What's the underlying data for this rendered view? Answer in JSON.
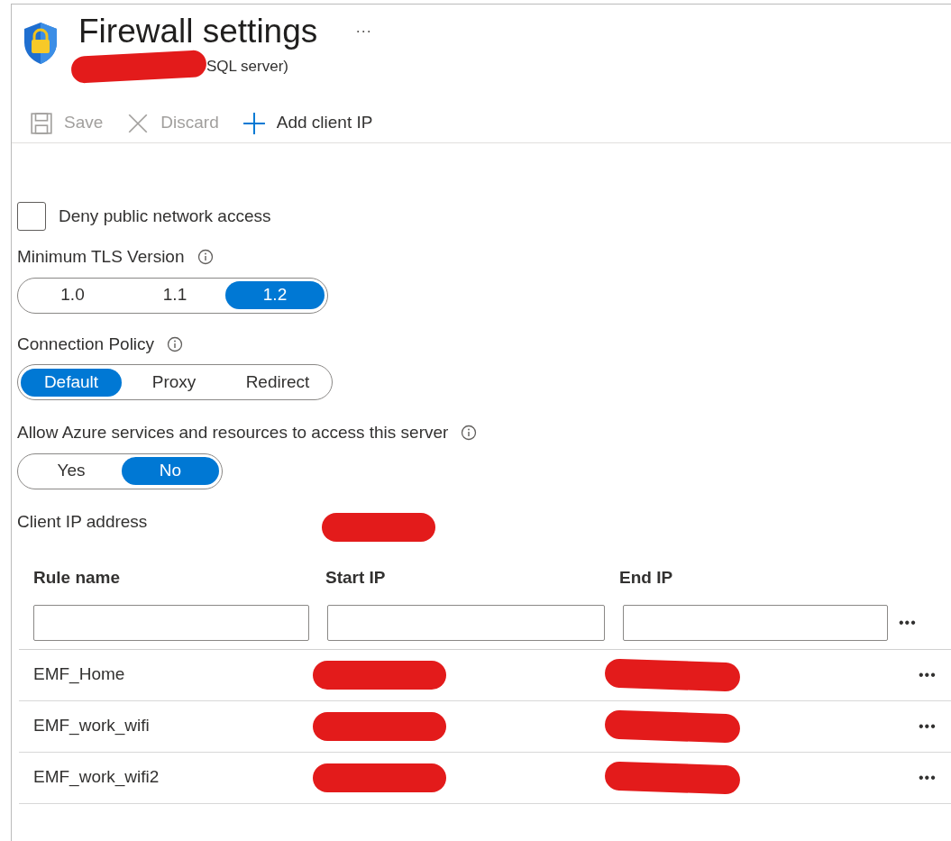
{
  "header": {
    "title": "Firewall settings",
    "more": "···",
    "subtitle": "SQL server)",
    "subtitle_redacted": true
  },
  "toolbar": [
    {
      "kind": "save",
      "label": "Save",
      "disabled": true
    },
    {
      "kind": "discard",
      "label": "Discard",
      "disabled": true
    },
    {
      "kind": "add",
      "label": "Add client IP",
      "disabled": false
    }
  ],
  "deny_public": {
    "label": "Deny public network access",
    "checked": false
  },
  "tls": {
    "label": "Minimum TLS Version",
    "options": [
      {
        "label": "1.0",
        "selected": false
      },
      {
        "label": "1.1",
        "selected": false
      },
      {
        "label": "1.2",
        "selected": true
      }
    ]
  },
  "policy": {
    "label": "Connection Policy",
    "options": [
      {
        "label": "Default",
        "selected": true
      },
      {
        "label": "Proxy",
        "selected": false
      },
      {
        "label": "Redirect",
        "selected": false
      }
    ]
  },
  "azure": {
    "label": "Allow Azure services and resources to access this server",
    "options": [
      {
        "label": "Yes",
        "selected": false
      },
      {
        "label": "No",
        "selected": true
      }
    ]
  },
  "client_ip": {
    "label": "Client IP address",
    "redacted": true
  },
  "table": {
    "columns": [
      "Rule name",
      "Start IP",
      "End IP"
    ],
    "more": "•••",
    "rows": [
      {
        "name": "EMF_Home",
        "start_redacted": true,
        "end_redacted": true,
        "more": "•••"
      },
      {
        "name": "EMF_work_wifi",
        "start_redacted": true,
        "end_redacted": true,
        "more": "•••"
      },
      {
        "name": "EMF_work_wifi2",
        "start_redacted": true,
        "end_redacted": true,
        "more": "•••"
      }
    ]
  }
}
